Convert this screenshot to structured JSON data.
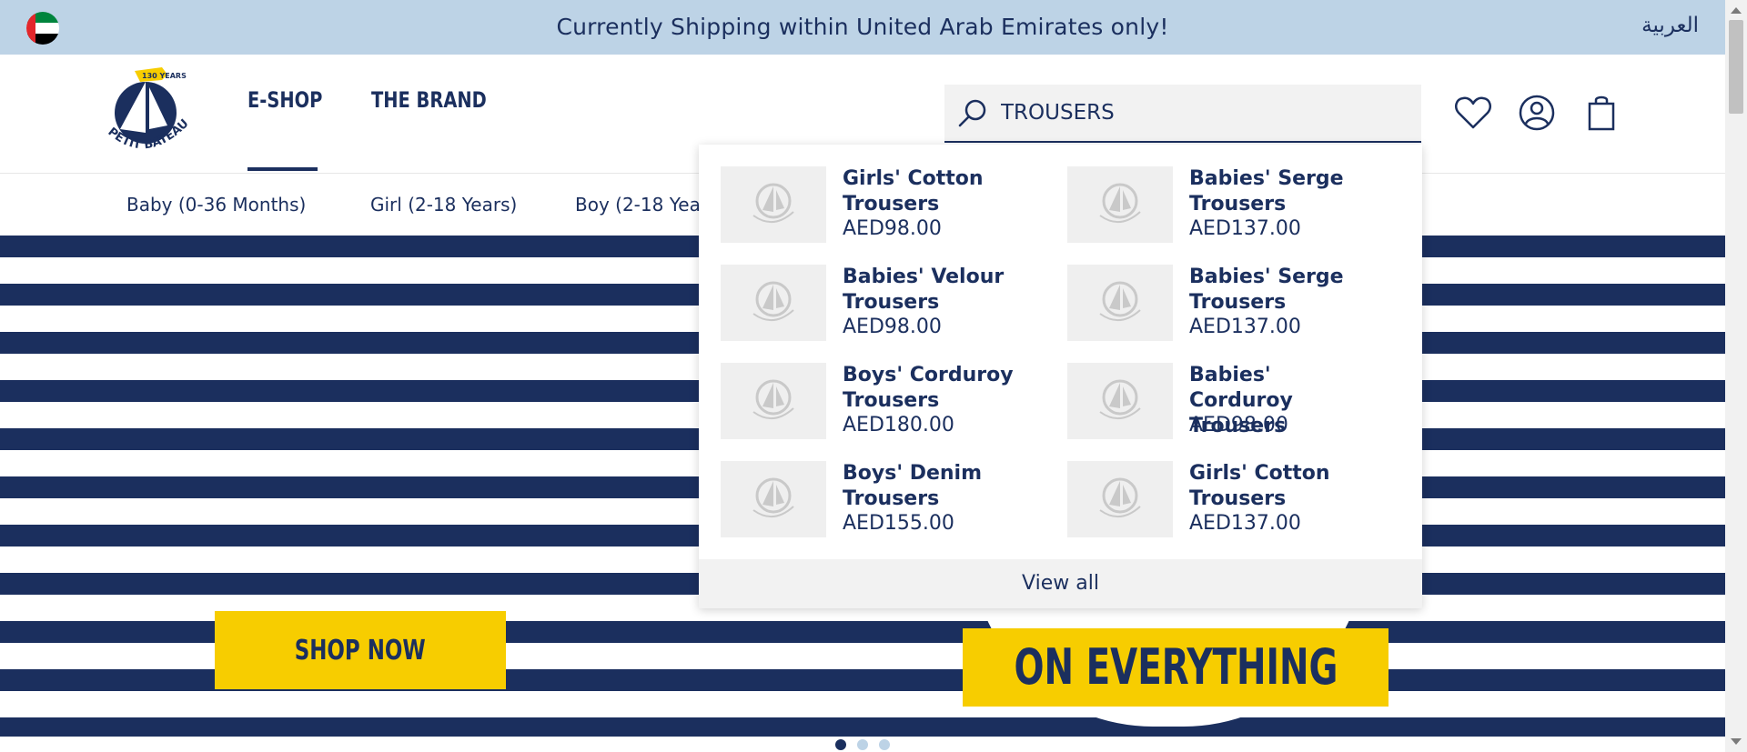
{
  "topbar": {
    "message": "Currently Shipping within United Arab Emirates only!",
    "language_link": "العربية",
    "flag_icon": "uae-flag-icon"
  },
  "header": {
    "logo_text": "PETIT BATEAU",
    "logo_badge": "130 YEARS",
    "nav": [
      {
        "label": "E-SHOP",
        "active": true
      },
      {
        "label": "THE BRAND",
        "active": false
      }
    ],
    "search": {
      "value": "TROUSERS",
      "icon": "search-icon"
    },
    "icons": [
      "heart-icon",
      "account-icon",
      "shopping-bag-icon"
    ]
  },
  "categories": [
    "Baby (0-36 Months)",
    "Girl (2-18 Years)",
    "Boy (2-18 Yea"
  ],
  "search_results": {
    "items": [
      {
        "name": "Girls' Cotton Trousers",
        "price": "AED98.00"
      },
      {
        "name": "Babies' Serge Trousers",
        "price": "AED137.00"
      },
      {
        "name": "Babies' Velour Trousers",
        "price": "AED98.00"
      },
      {
        "name": "Babies' Serge Trousers",
        "price": "AED137.00"
      },
      {
        "name": "Boys' Corduroy Trousers",
        "price": "AED180.00"
      },
      {
        "name": "Babies' Corduroy Trousers",
        "price": "AED98.00"
      },
      {
        "name": "Boys' Denim Trousers",
        "price": "AED155.00"
      },
      {
        "name": "Girls' Cotton Trousers",
        "price": "AED137.00"
      }
    ],
    "view_all": "View all"
  },
  "hero": {
    "shop_now": "SHOP NOW",
    "banner_text": "ON EVERYTHING",
    "slides": 3,
    "active_slide": 1
  },
  "colors": {
    "navy": "#1b2f5e",
    "light_blue": "#bdd3e6",
    "yellow": "#f7cd00"
  }
}
